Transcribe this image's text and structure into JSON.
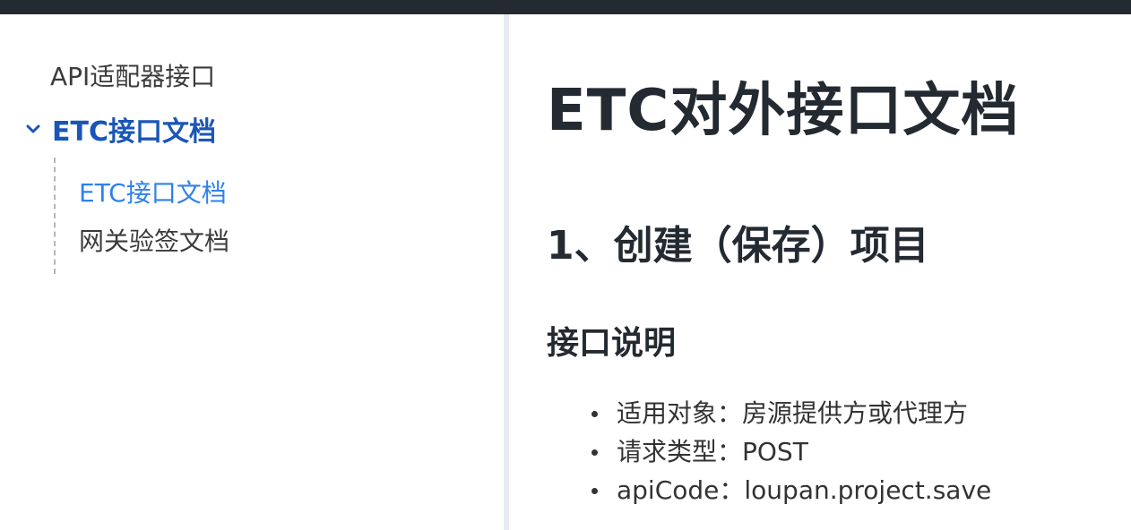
{
  "sidebar": {
    "top_item": "API适配器接口",
    "group": {
      "label": "ETC接口文档",
      "children": [
        {
          "label": "ETC接口文档",
          "active": true
        },
        {
          "label": "网关验签文档",
          "active": false
        }
      ]
    }
  },
  "content": {
    "title": "ETC对外接口文档",
    "section_heading": "1、创建（保存）项目",
    "subsection_heading": "接口说明",
    "bullets": [
      "适用对象：房源提供方或代理方",
      "请求类型：POST",
      "apiCode：loupan.project.save"
    ]
  },
  "icons": {
    "group_toggle": "chevron-down-icon",
    "bullet": "bullet-dot-icon"
  },
  "colors": {
    "topbar": "#242a31",
    "nav_group": "#1a56b8",
    "nav_active": "#2f80ed",
    "divider": "#e6ecf1"
  }
}
